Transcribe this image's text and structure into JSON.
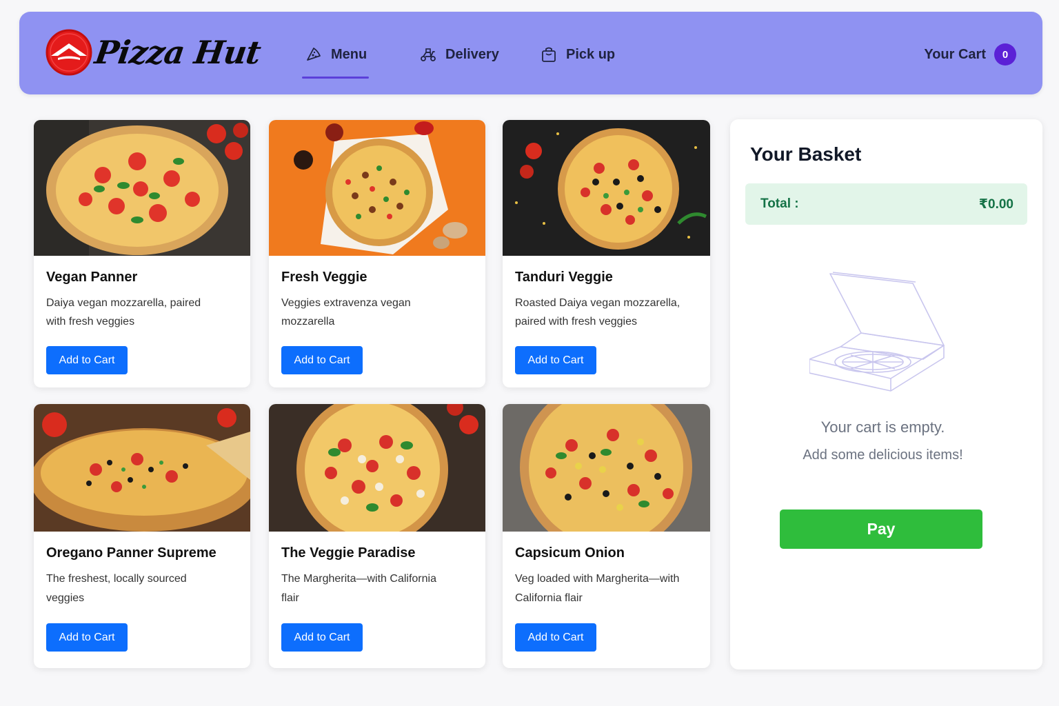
{
  "brand": {
    "name": "Pizza Hut",
    "accent": "#8f92f2",
    "logo_red": "#e41b1b"
  },
  "nav": {
    "items": [
      {
        "label": "Menu",
        "icon": "pizza-slice-icon",
        "active": true
      },
      {
        "label": "Delivery",
        "icon": "scooter-icon",
        "active": false
      },
      {
        "label": "Pick up",
        "icon": "shopping-bag-icon",
        "active": false
      }
    ],
    "cart_label": "Your Cart",
    "cart_count": "0"
  },
  "products": [
    {
      "title": "Vegan Panner",
      "description": "Daiya vegan mozzarella, paired with fresh veggies",
      "button": "Add to Cart"
    },
    {
      "title": "Fresh Veggie",
      "description": "Veggies extravenza vegan mozzarella",
      "button": "Add to Cart"
    },
    {
      "title": "Tanduri Veggie",
      "description": "Roasted Daiya vegan mozzarella, paired with fresh veggies",
      "button": "Add to Cart"
    },
    {
      "title": "Oregano Panner Supreme",
      "description": "The freshest, locally sourced veggies",
      "button": "Add to Cart"
    },
    {
      "title": "The Veggie Paradise",
      "description": "The Margherita—with California flair",
      "button": "Add to Cart"
    },
    {
      "title": "Capsicum Onion",
      "description": "Veg loaded with Margherita—with California flair",
      "button": "Add to Cart"
    }
  ],
  "basket": {
    "title": "Your Basket",
    "total_label": "Total :",
    "total_value": "₹0.00",
    "empty_title": "Your cart is empty.",
    "empty_subtitle": "Add some delicious items!",
    "pay_label": "Pay"
  },
  "colors": {
    "primary_button": "#0d6efd",
    "pay_button": "#2fbd3c",
    "total_bg": "#e2f5e9",
    "total_text": "#157347",
    "badge": "#5b21d6"
  }
}
